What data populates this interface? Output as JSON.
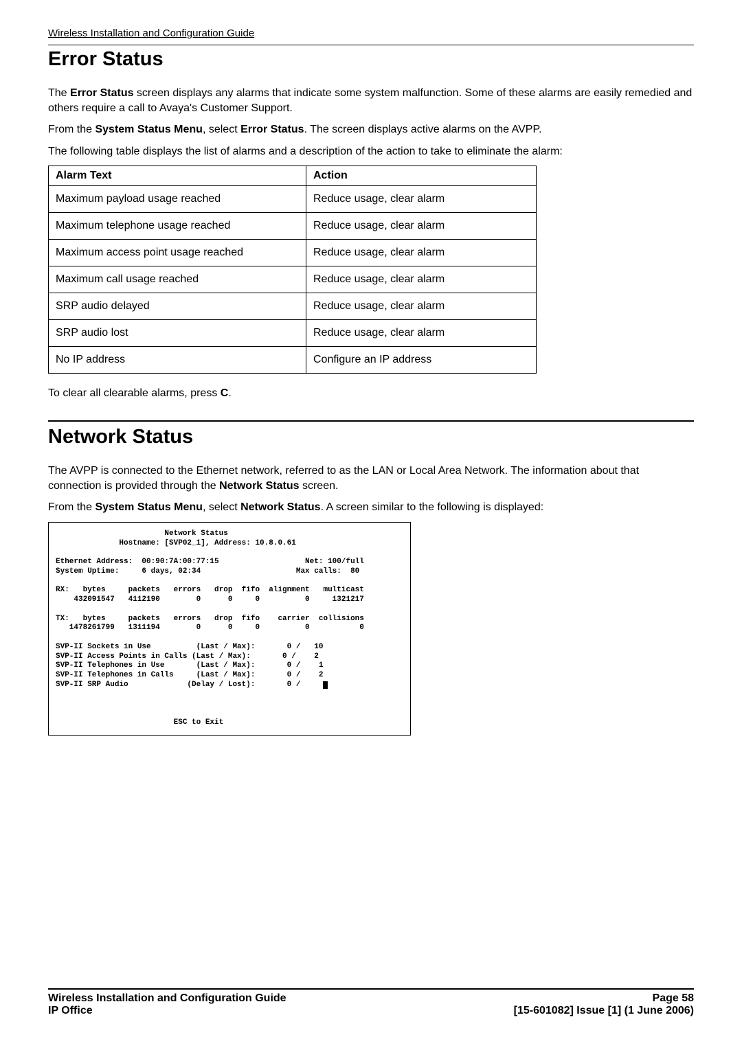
{
  "running_header": "Wireless Installation and Configuration Guide",
  "error_status": {
    "title": "Error Status",
    "para1_a": "The ",
    "para1_b": "Error Status",
    "para1_c": " screen displays any alarms that indicate some system malfunction. Some of these alarms are easily remedied and others require a call to Avaya's Customer Support.",
    "para2_a": "From the ",
    "para2_b": "System Status Menu",
    "para2_c": ", select ",
    "para2_d": "Error Status",
    "para2_e": ". The screen displays active alarms on the AVPP.",
    "para3": "The following table displays the list of alarms and a description of the action to take to eliminate the alarm:",
    "table": {
      "header_alarm": "Alarm Text",
      "header_action": "Action",
      "rows": [
        {
          "alarm": "Maximum payload usage reached",
          "action": "Reduce usage, clear alarm"
        },
        {
          "alarm": "Maximum telephone usage reached",
          "action": "Reduce usage, clear alarm"
        },
        {
          "alarm": "Maximum access point usage reached",
          "action": "Reduce usage, clear alarm"
        },
        {
          "alarm": "Maximum call usage reached",
          "action": "Reduce usage, clear alarm"
        },
        {
          "alarm": "SRP audio delayed",
          "action": "Reduce usage, clear alarm"
        },
        {
          "alarm": "SRP audio lost",
          "action": "Reduce usage, clear alarm"
        },
        {
          "alarm": "No IP address",
          "action": "Configure an IP address"
        }
      ]
    },
    "clear_a": "To clear all clearable alarms, press ",
    "clear_b": "C",
    "clear_c": "."
  },
  "network_status": {
    "title": "Network Status",
    "para1_a": "The AVPP is connected to the Ethernet network, referred to as the LAN or Local Area Network. The information about that connection is provided through the ",
    "para1_b": "Network Status",
    "para1_c": " screen.",
    "para2_a": "From the ",
    "para2_b": "System Status Menu",
    "para2_c": ", select ",
    "para2_d": "Network Status",
    "para2_e": ". A screen similar to the following is displayed:"
  },
  "terminal": {
    "title_line": "                        Network Status",
    "hostname_line": "              Hostname: [SVP02_1], Address: 10.8.0.61",
    "eth_line": "Ethernet Address:  00:90:7A:00:77:15                   Net: 100/full",
    "uptime_line": "System Uptime:     6 days, 02:34                     Max calls:  80",
    "rx_header": "RX:   bytes     packets   errors   drop  fifo  alignment   multicast",
    "rx_values": "    432091547   4112190        0      0     0          0     1321217",
    "tx_header": "TX:   bytes     packets   errors   drop  fifo    carrier  collisions",
    "tx_values": "   1478261799   1311194        0      0     0          0           0",
    "svp_sockets": "SVP-II Sockets in Use          (Last / Max):       0 /   10",
    "svp_access": "SVP-II Access Points in Calls (Last / Max):       0 /    2",
    "svp_tel_use": "SVP-II Telephones in Use       (Last / Max):       0 /    1",
    "svp_tel_calls": "SVP-II Telephones in Calls     (Last / Max):       0 /    2",
    "svp_srp_audio": "SVP-II SRP Audio             (Delay / Lost):       0 /     ",
    "esc_line": "                          ESC to Exit"
  },
  "footer": {
    "left1": "Wireless Installation and Configuration Guide",
    "left2": "IP Office",
    "right1": "Page 58",
    "right2": "[15-601082] Issue [1] (1 June 2006)"
  }
}
